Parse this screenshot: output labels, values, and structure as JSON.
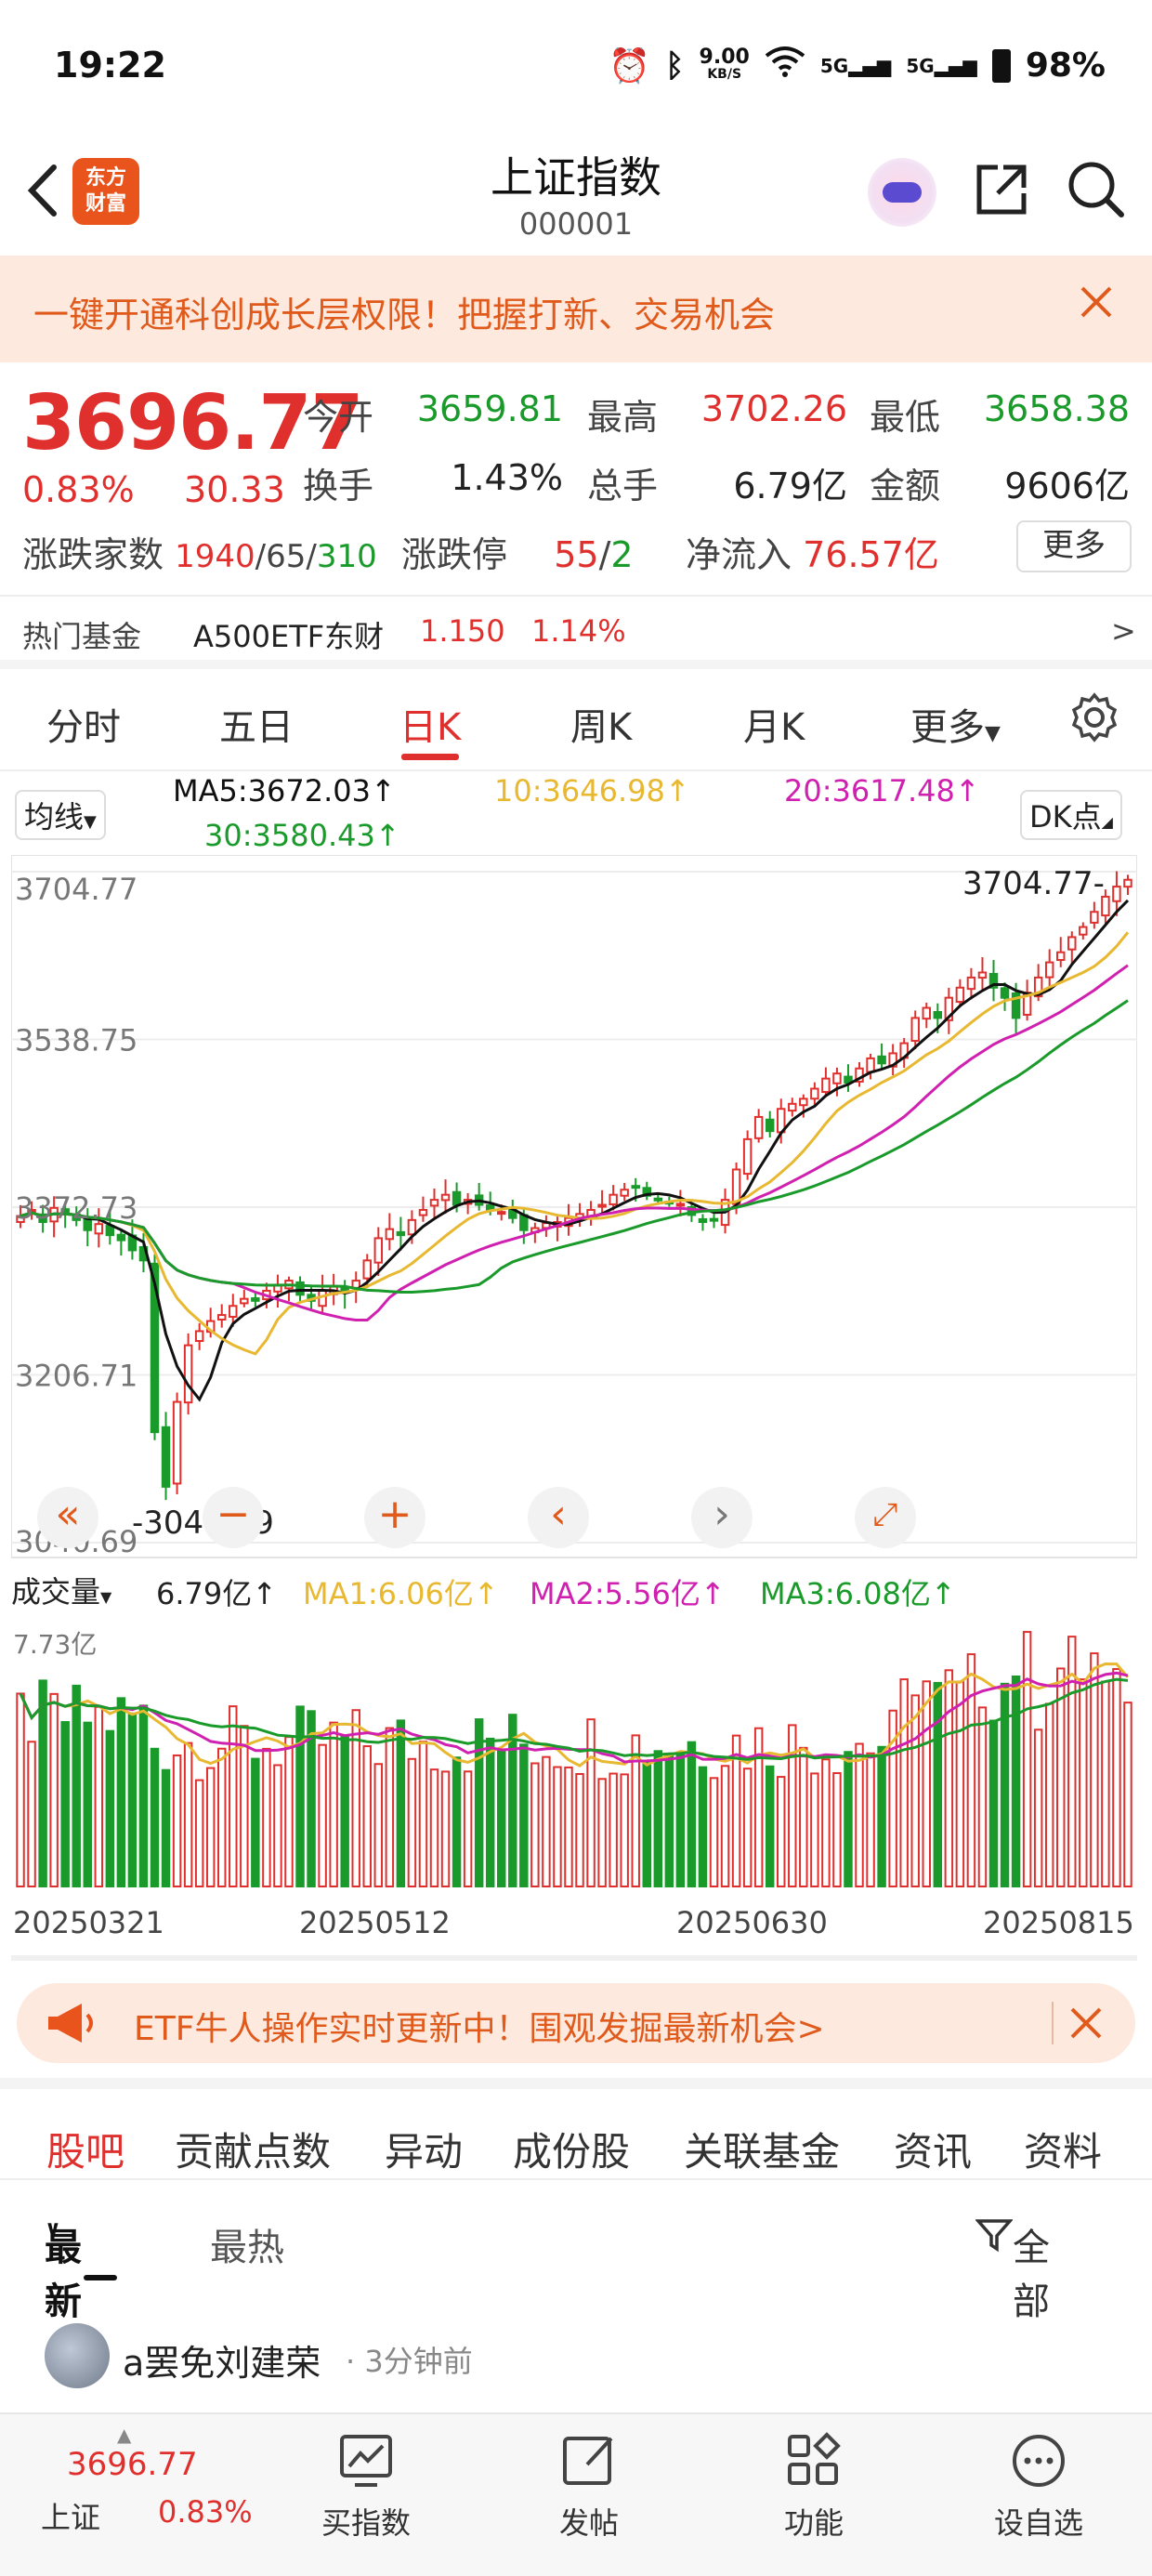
{
  "status": {
    "time": "19:22",
    "speed": "9.00",
    "speed_unit": "KB/S",
    "net1": "5G",
    "net2": "5G",
    "battery": "98%"
  },
  "header": {
    "title": "上证指数",
    "code": "000001",
    "logo_text_1": "东方",
    "logo_text_2": "财富"
  },
  "banner": {
    "text": "一键开通科创成长层权限！把握打新、交易机会"
  },
  "quote": {
    "price": "3696.77",
    "pct": "0.83%",
    "change": "30.33",
    "open_label": "今开",
    "open": "3659.81",
    "high_label": "最高",
    "high": "3702.26",
    "low_label": "最低",
    "low": "3658.38",
    "turnover_label": "换手",
    "turnover": "1.43%",
    "volume_label": "总手",
    "volume": "6.79亿",
    "amount_label": "金额",
    "amount": "9606亿",
    "breadth_label": "涨跌家数",
    "breadth_up": "1940",
    "breadth_flat": "65",
    "breadth_down": "310",
    "limit_label": "涨跌停",
    "limit_up": "55",
    "limit_down": "2",
    "inflow_label": "净流入",
    "inflow": "76.57亿",
    "more_label": "更多"
  },
  "hot_fund": {
    "label": "热门基金",
    "name": "A500ETF东财",
    "price": "1.150",
    "pct": "1.14%",
    "arrow": ">"
  },
  "k_tabs": [
    "分时",
    "五日",
    "日K",
    "周K",
    "月K",
    "更多"
  ],
  "k_tab_active": 2,
  "ma_legend": {
    "selector": "均线",
    "ma5": "MA5:3672.03↑",
    "ma10": "10:3646.98↑",
    "ma20": "20:3617.48↑",
    "ma30": "30:3580.43↑",
    "dk": "DK点"
  },
  "colors": {
    "up": "#e0302e",
    "down": "#1a9a2a",
    "ma5": "#111111",
    "ma10": "#e8b830",
    "ma20": "#d020b0",
    "ma30": "#1a9a2a",
    "accent": "#e05a1c"
  },
  "chart_data": {
    "type": "candlestick",
    "title": "",
    "y_ticks": [
      "3704.77",
      "3538.75",
      "3372.73",
      "3206.71",
      "3040.69"
    ],
    "ylim": [
      3040.69,
      3704.77
    ],
    "x_ticks": [
      "20250321",
      "20250512",
      "20250630",
      "20250815"
    ],
    "max_label": "3704.77",
    "min_label": "3040.69",
    "close": [
      3364,
      3370,
      3358,
      3372,
      3366,
      3360,
      3350,
      3356,
      3345,
      3340,
      3330,
      3320,
      3150,
      3096,
      3180,
      3236,
      3250,
      3260,
      3266,
      3275,
      3282,
      3280,
      3290,
      3296,
      3300,
      3286,
      3280,
      3290,
      3294,
      3288,
      3300,
      3320,
      3342,
      3351,
      3345,
      3360,
      3370,
      3380,
      3385,
      3375,
      3380,
      3375,
      3370,
      3368,
      3362,
      3350,
      3352,
      3357,
      3358,
      3362,
      3366,
      3370,
      3375,
      3385,
      3390,
      3392,
      3384,
      3380,
      3378,
      3376,
      3365,
      3358,
      3360,
      3380,
      3410,
      3440,
      3462,
      3448,
      3470,
      3475,
      3480,
      3490,
      3500,
      3505,
      3496,
      3510,
      3520,
      3515,
      3525,
      3535,
      3560,
      3570,
      3560,
      3580,
      3590,
      3600,
      3605,
      3590,
      3580,
      3560,
      3585,
      3600,
      3615,
      3625,
      3640,
      3650,
      3665,
      3680,
      3690,
      3696.77
    ],
    "volume_ylabel": "7.73亿",
    "volume_label": "成交量",
    "volume_value": "6.79亿↑",
    "vol_ma1": "MA1:6.06亿↑",
    "vol_ma2": "MA2:5.56亿↑",
    "vol_ma3": "MA3:6.08亿↑"
  },
  "etf_banner": {
    "text": "ETF牛人操作实时更新中！围观发掘最新机会>"
  },
  "bottom_tabs": [
    "股吧",
    "贡献点数",
    "异动",
    "成份股",
    "关联基金",
    "资讯",
    "资料"
  ],
  "sort": {
    "latest": "最新",
    "hottest": "最热",
    "filter": "全部"
  },
  "post": {
    "user": "a罢免刘建荣",
    "time": "· 3分钟前"
  },
  "bottom_bar": {
    "price": "3696.77",
    "name": "上证",
    "pct": "0.83%",
    "items": [
      "买指数",
      "发帖",
      "功能",
      "设自选"
    ]
  }
}
